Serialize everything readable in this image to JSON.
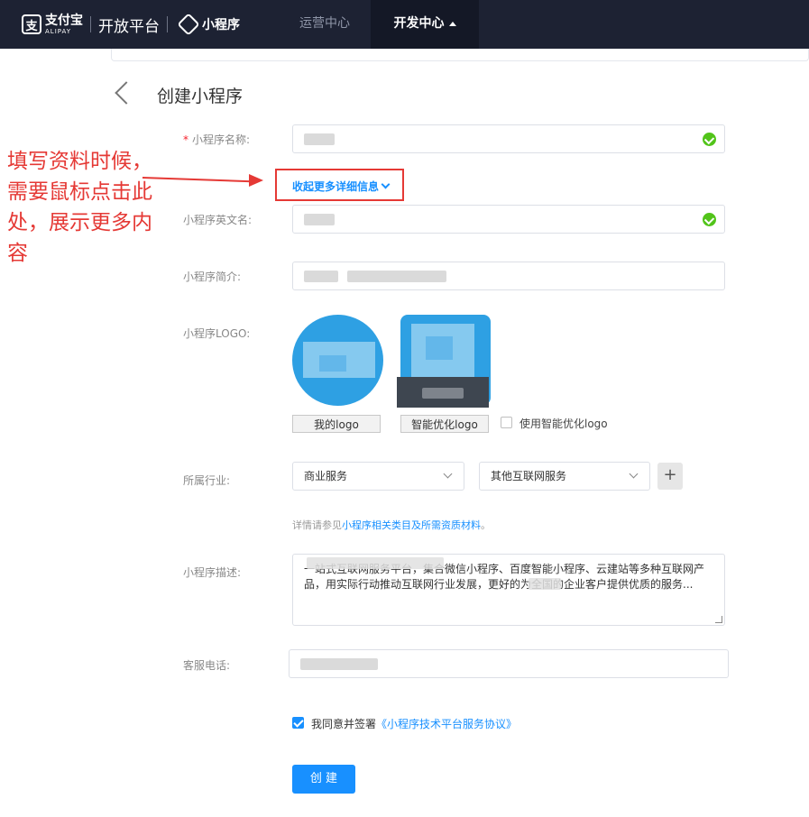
{
  "header": {
    "alipay_cn": "支付宝",
    "alipay_en": "ALIPAY",
    "platform": "开放平台",
    "mini_title": "小程序",
    "nav_ops": "运营中心",
    "nav_dev": "开发中心"
  },
  "page": {
    "title": "创建小程序"
  },
  "annotation": {
    "text": "填写资料时候，需要鼠标点击此处，展示更多内容"
  },
  "form": {
    "name_label": "小程序名称:",
    "name_required": "*",
    "toggle_details": "收起更多详细信息",
    "en_name_label": "小程序英文名:",
    "intro_label": "小程序简介:",
    "logo_label": "小程序LOGO:",
    "my_logo_btn": "我的logo",
    "smart_logo_btn": "智能优化logo",
    "use_smart_logo": "使用智能优化logo",
    "industry_label": "所属行业:",
    "industry_primary": "商业服务",
    "industry_secondary": "其他互联网服务",
    "plus": "+",
    "hint_prefix": "详情请参见",
    "hint_link": "小程序相关类目及所需资质材料",
    "hint_suffix": "。",
    "desc_label": "小程序描述:",
    "desc_text": "一站式互联网服务平台，集合微信小程序、百度智能小程序、云建站等多种互联网产品，用实际行动推动互联网行业发展，更好的为全国的企业客户提供优质的服务...",
    "phone_label": "客服电话:",
    "agree_text": "我同意并签署",
    "agree_link": "《小程序技术平台服务协议》",
    "submit": "创 建"
  },
  "colors": {
    "accent": "#1890ff",
    "header_bg": "#1d2233",
    "annotation": "#e53935",
    "success": "#52c41a"
  }
}
